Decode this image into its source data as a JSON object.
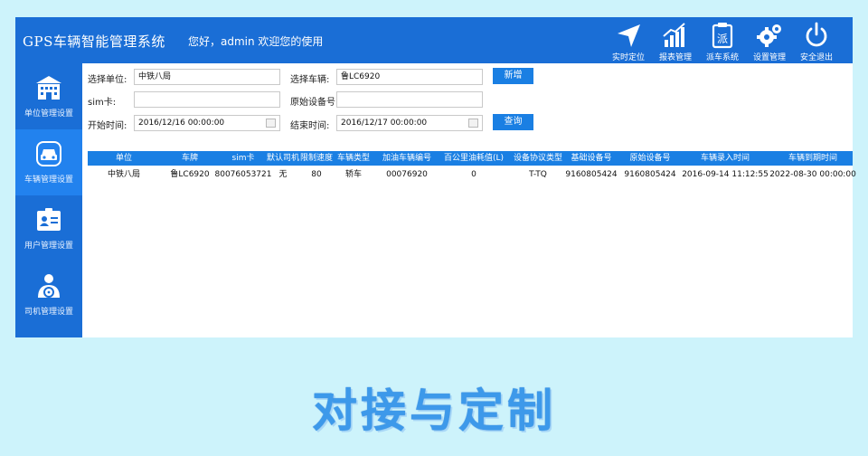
{
  "header": {
    "title": "GPS车辆智能管理系统",
    "greeting": "您好，admin 欢迎您的使用",
    "nav": [
      {
        "label": "实时定位",
        "icon": "navigation-arrow-icon"
      },
      {
        "label": "报表管理",
        "icon": "bar-chart-icon"
      },
      {
        "label": "派车系统",
        "icon": "dispatch-icon"
      },
      {
        "label": "设置管理",
        "icon": "gears-icon"
      },
      {
        "label": "安全退出",
        "icon": "power-icon"
      }
    ],
    "dispatch_glyph": "派"
  },
  "sidebar": {
    "items": [
      {
        "label": "单位管理设置",
        "icon": "building-icon",
        "active": false
      },
      {
        "label": "车辆管理设置",
        "icon": "car-icon",
        "active": true
      },
      {
        "label": "用户管理设置",
        "icon": "id-card-icon",
        "active": false
      },
      {
        "label": "司机管理设置",
        "icon": "driver-icon",
        "active": false
      }
    ]
  },
  "form": {
    "unit_label": "选择单位:",
    "unit_value": "中铁八局",
    "vehicle_label": "选择车辆:",
    "vehicle_value": "鲁LC6920",
    "add_button": "新增",
    "sim_label": "sim卡:",
    "sim_value": "",
    "device_label": "原始设备号:",
    "device_value": "",
    "start_label": "开始时间:",
    "start_value": "2016/12/16 00:00:00",
    "end_label": "结束时间:",
    "end_value": "2016/12/17 00:00:00",
    "query_button": "查询"
  },
  "table": {
    "columns": [
      "单位",
      "车牌",
      "sim卡",
      "默认司机",
      "限制速度",
      "车辆类型",
      "加油车辆编号",
      "百公里油耗值(L)",
      "设备协议类型",
      "基础设备号",
      "原始设备号",
      "车辆录入时间",
      "车辆到期时间"
    ],
    "rows": [
      [
        "中铁八局",
        "鲁LC6920",
        "80076053721",
        "无",
        "80",
        "轿车",
        "00076920",
        "0",
        "T-TQ",
        "9160805424",
        "9160805424",
        "2016-09-14 11:12:55",
        "2022-08-30 00:00:00"
      ]
    ]
  },
  "banner": "对接与定制",
  "colors": {
    "primary": "#1a6ed6",
    "active": "#2282ee",
    "button": "#1a7fe3",
    "background": "#cdf3fb"
  }
}
